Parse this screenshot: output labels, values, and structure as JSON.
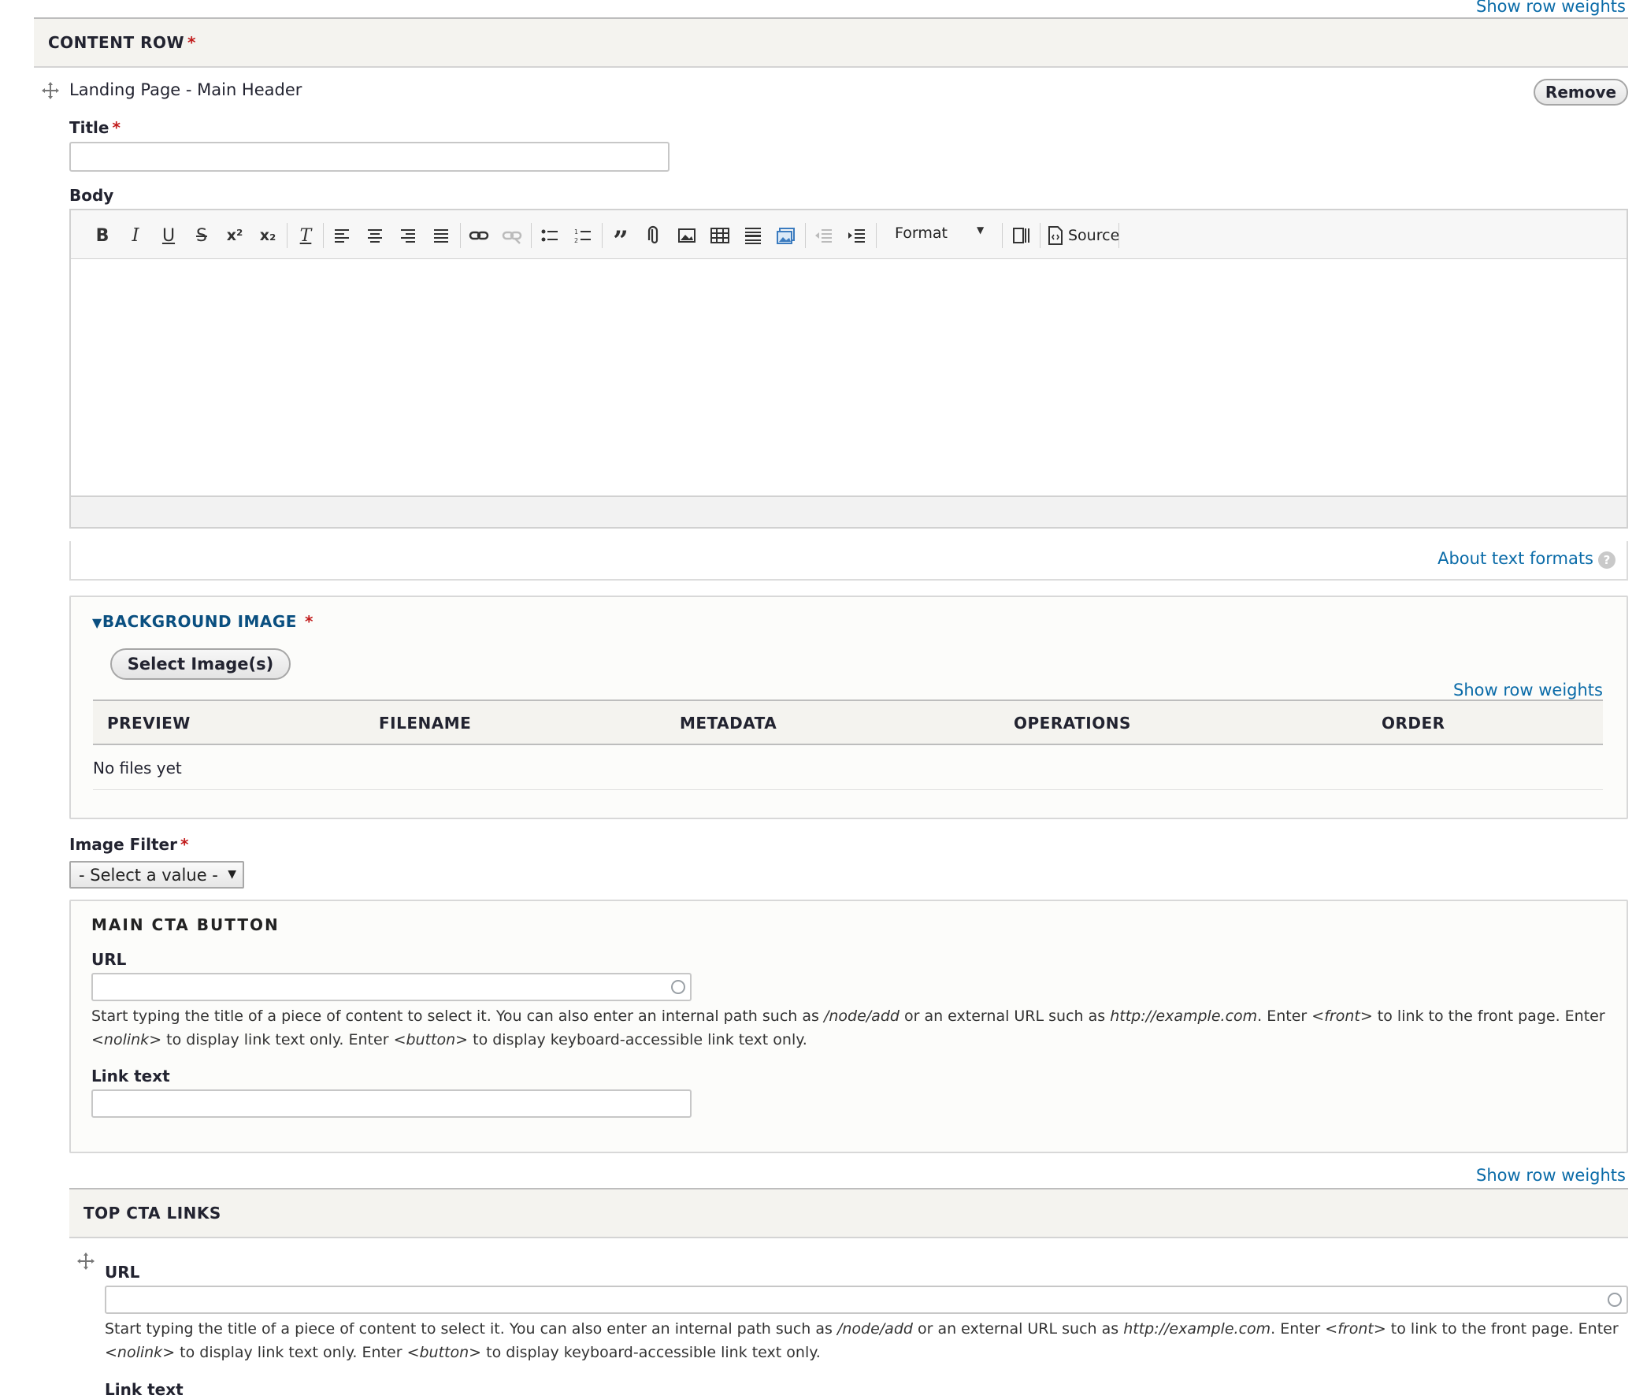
{
  "top_link": "Show row weights",
  "content_row": {
    "header": "CONTENT ROW",
    "item_title": "Landing Page - Main Header",
    "remove_label": "Remove"
  },
  "title_field": {
    "label": "Title",
    "value": ""
  },
  "body_field": {
    "label": "Body",
    "toolbar": {
      "format_label": "Format",
      "source_label": "Source",
      "buttons": [
        "bold-icon",
        "italic-icon",
        "underline-icon",
        "strikethrough-icon",
        "superscript-icon",
        "subscript-icon",
        "remove-format-icon",
        "align-left-icon",
        "align-center-icon",
        "align-right-icon",
        "justify-icon",
        "link-icon",
        "unlink-icon",
        "bulleted-list-icon",
        "numbered-list-icon",
        "blockquote-icon",
        "attachment-icon",
        "image-icon",
        "table-icon",
        "horizontal-rule-icon",
        "media-icon",
        "outdent-icon",
        "indent-icon",
        "show-blocks-icon",
        "source-icon"
      ]
    },
    "about_formats": "About text formats"
  },
  "background_image": {
    "legend": "BACKGROUND IMAGE",
    "select_button": "Select Image(s)",
    "row_weights": "Show row weights",
    "columns": [
      "PREVIEW",
      "FILENAME",
      "METADATA",
      "OPERATIONS",
      "ORDER"
    ],
    "empty_text": "No files yet"
  },
  "image_filter": {
    "label": "Image Filter",
    "selected": "- Select a value -"
  },
  "main_cta": {
    "legend": "MAIN CTA BUTTON",
    "url_label": "URL",
    "url_value": "",
    "desc_1": "Start typing the title of a piece of content to select it. You can also enter an internal path such as",
    "desc_path": "/node/add",
    "desc_2": "or an external URL such as",
    "desc_url": "http://example.com",
    "desc_3": ". Enter",
    "desc_front": "<front>",
    "desc_4": "to link to the front page. Enter",
    "desc_nolink": "<nolink>",
    "desc_5": "to display link text only. Enter",
    "desc_button": "<button>",
    "desc_6": "to display keyboard-accessible link text only.",
    "link_text_label": "Link text",
    "link_text_value": ""
  },
  "top_cta": {
    "row_weights": "Show row weights",
    "header": "TOP CTA LINKS",
    "url_label": "URL",
    "link_text_label": "Link text"
  },
  "colors": {
    "link": "#0a6ba8",
    "required": "#c21d1d",
    "header_bg": "#f4f3ef"
  }
}
